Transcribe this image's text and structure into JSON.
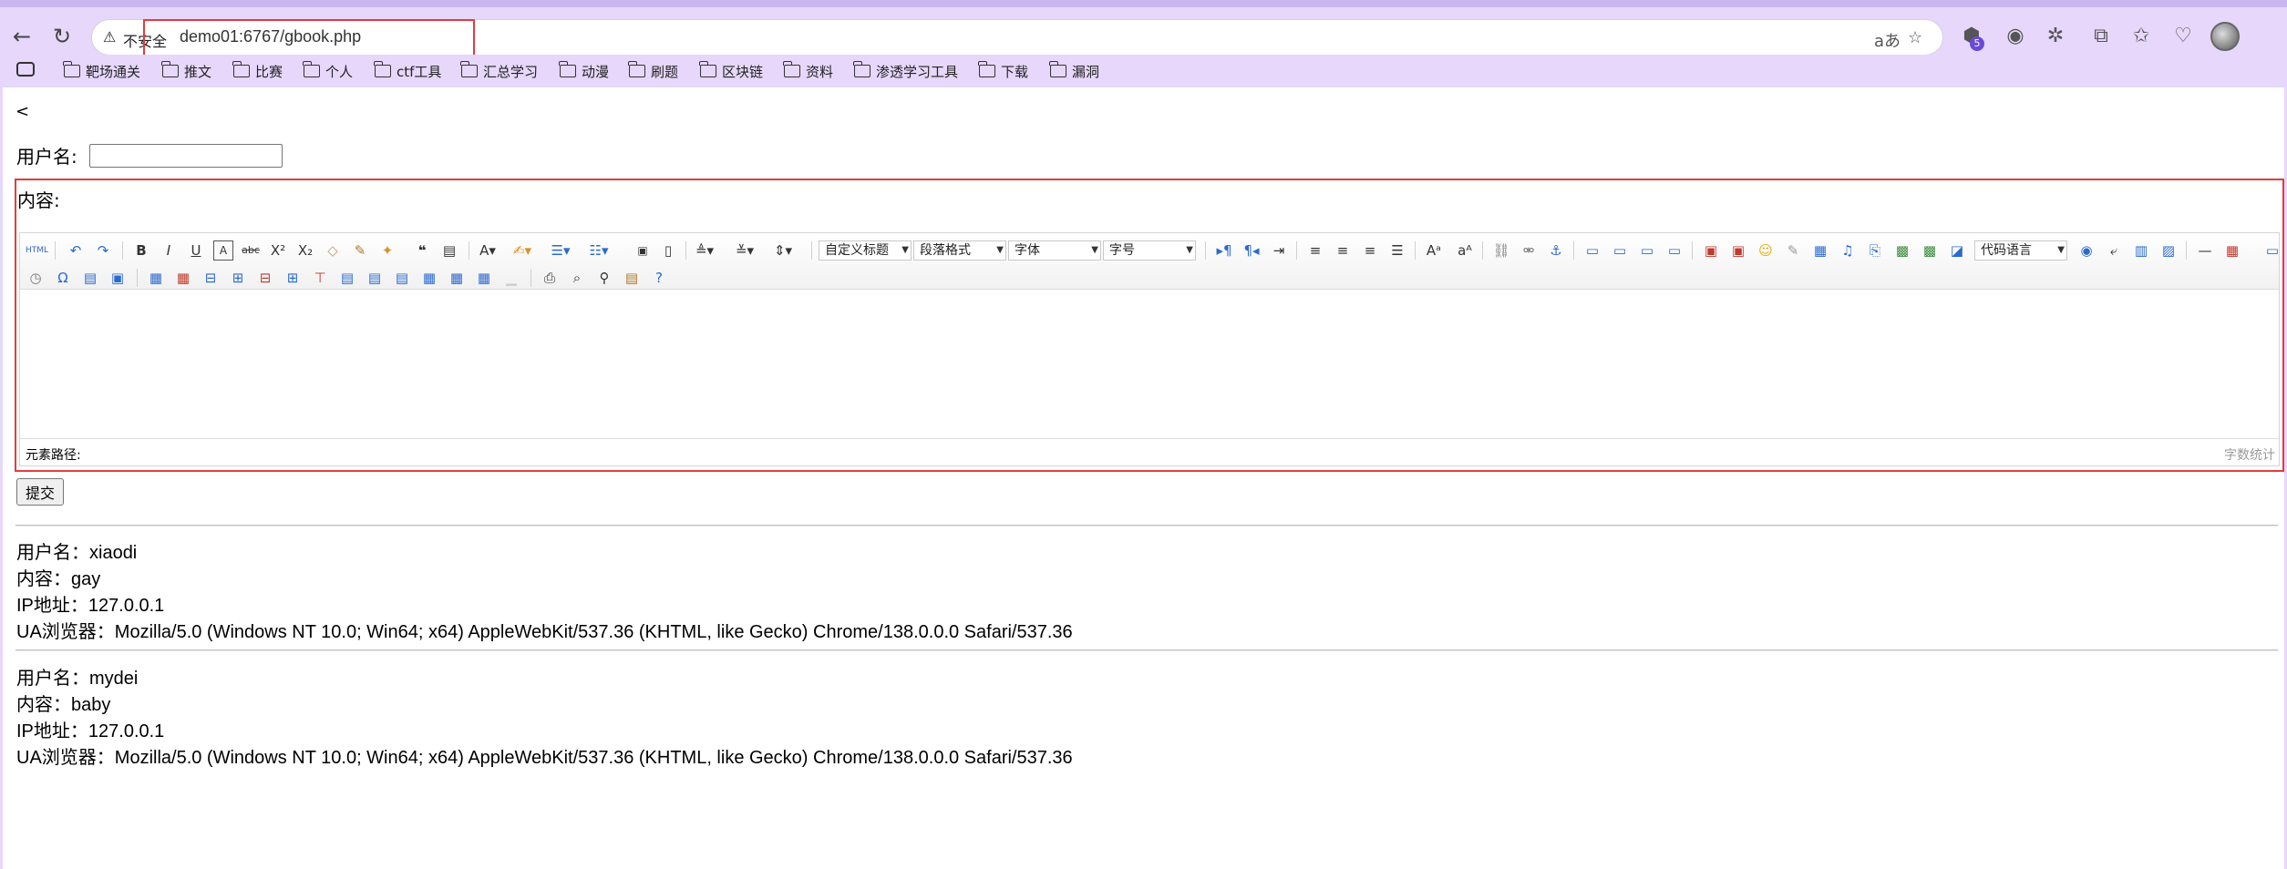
{
  "browser": {
    "security_text": "不安全",
    "url": "demo01:6767/gbook.php",
    "badge_count": "5",
    "reader_label": "aあ"
  },
  "bookmarks": [
    "靶场通关",
    "推文",
    "比赛",
    "个人",
    "ctf工具",
    "汇总学习",
    "动漫",
    "刷题",
    "区块链",
    "资料",
    "渗透学习工具",
    "下载",
    "漏洞"
  ],
  "page": {
    "back_text": "<",
    "username_label": "用户名:",
    "content_label": "内容:",
    "submit_label": "提交"
  },
  "editor": {
    "selects": [
      "自定义标题",
      "段落格式",
      "字体",
      "字号",
      "代码语言"
    ],
    "path_label": "元素路径:",
    "count_label": "字数统计"
  },
  "entries": [
    {
      "username": "用户名：xiaodi",
      "content": "内容：gay",
      "ip": "IP地址：127.0.0.1",
      "ua": "UA浏览器：Mozilla/5.0 (Windows NT 10.0; Win64; x64) AppleWebKit/537.36 (KHTML, like Gecko) Chrome/138.0.0.0 Safari/537.36"
    },
    {
      "username": "用户名：mydei",
      "content": "内容：baby",
      "ip": "IP地址：127.0.0.1",
      "ua": "UA浏览器：Mozilla/5.0 (Windows NT 10.0; Win64; x64) AppleWebKit/537.36 (KHTML, like Gecko) Chrome/138.0.0.0 Safari/537.36"
    }
  ],
  "colors": {
    "chrome_bg": "#e6d7fb",
    "highlight_red": "#e23c3c"
  }
}
